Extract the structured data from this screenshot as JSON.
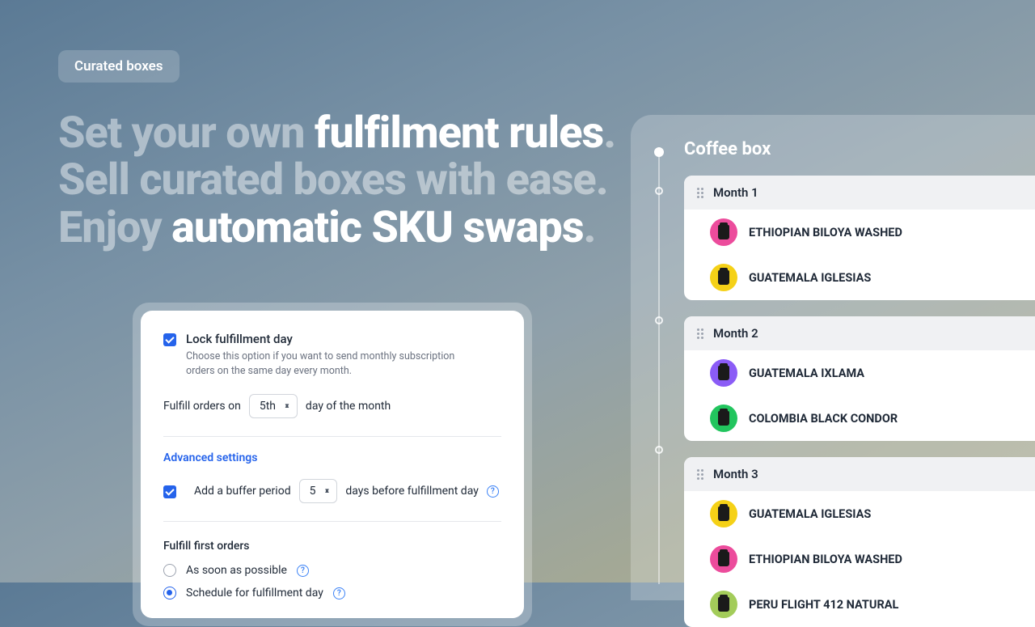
{
  "pill": "Curated boxes",
  "headlines": [
    {
      "dim": "Set your own ",
      "bright": "fulfilment rules",
      "punct": "."
    },
    {
      "dim": "Sell curated boxes with ease.",
      "bright": "",
      "punct": ""
    },
    {
      "dim": "Enjoy ",
      "bright": "automatic SKU swaps",
      "punct": "."
    }
  ],
  "card": {
    "lock_label": "Lock fulfillment day",
    "lock_sub": "Choose this option if you want to send monthly subscription orders on the same day every month.",
    "fulfill_prefix": "Fulfill orders on",
    "fulfill_value": "5th",
    "fulfill_suffix": "day of the month",
    "advanced": "Advanced settings",
    "buffer_label": "Add a buffer period",
    "buffer_value": "5",
    "buffer_suffix": "days before fulfillment day",
    "first_orders_title": "Fulfill first orders",
    "radio_asap": "As soon as possible",
    "radio_schedule": "Schedule for fulfillment day"
  },
  "panel": {
    "title": "Coffee box",
    "months": [
      {
        "label": "Month 1",
        "items": [
          {
            "name": "ETHIOPIAN BILOYA WASHED",
            "color": "#ec4c9c"
          },
          {
            "name": "GUATEMALA IGLESIAS",
            "color": "#f5d117"
          }
        ]
      },
      {
        "label": "Month 2",
        "items": [
          {
            "name": "GUATEMALA IXLAMA",
            "color": "#8b5cf6"
          },
          {
            "name": "COLOMBIA BLACK CONDOR",
            "color": "#22c55e"
          }
        ]
      },
      {
        "label": "Month 3",
        "items": [
          {
            "name": "GUATEMALA IGLESIAS",
            "color": "#f5d117"
          },
          {
            "name": "ETHIOPIAN BILOYA WASHED",
            "color": "#ec4c9c"
          },
          {
            "name": "PERU FLIGHT 412 NATURAL",
            "color": "#a3cc5a"
          }
        ]
      }
    ]
  }
}
